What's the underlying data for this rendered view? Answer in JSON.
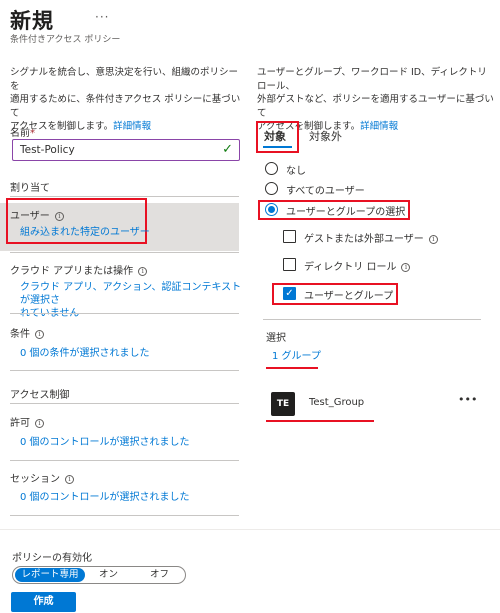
{
  "header": {
    "title": "新規",
    "more": "···",
    "subtitle": "条件付きアクセス ポリシー"
  },
  "left": {
    "description_line1": "シグナルを統合し、意思決定を行い、組織のポリシーを",
    "description_line2": "適用するために、条件付きアクセス ポリシーに基づいて",
    "description_line3": "アクセスを制御します。",
    "description_link": "詳細情報",
    "name_label": "名前",
    "name_required": "*",
    "name_value": "Test-Policy",
    "assignments_heading": "割り当て",
    "users_label": "ユーザー",
    "users_value": "組み込まれた特定のユーザー",
    "cloud_apps_label": "クラウド アプリまたは操作",
    "cloud_apps_value_line1": "クラウド アプリ、アクション、認証コンテキストが選択さ",
    "cloud_apps_value_line2": "れていません",
    "conditions_label": "条件",
    "conditions_value": "0 個の条件が選択されました",
    "access_controls_heading": "アクセス制御",
    "grant_label": "許可",
    "grant_value": "0 個のコントロールが選択されました",
    "session_label": "セッション",
    "session_value": "0 個のコントロールが選択されました"
  },
  "right": {
    "description_line1": "ユーザーとグループ、ワークロード ID、ディレクトリ ロール、",
    "description_line2": "外部ゲストなど、ポリシーを適用するユーザーに基づいて",
    "description_line3": "アクセスを制御します。",
    "description_link": "詳細情報",
    "tab_include": "対象",
    "tab_exclude": "対象外",
    "radio_none": "なし",
    "radio_all_users": "すべてのユーザー",
    "radio_select": "ユーザーとグループの選択",
    "check_guest": "ゲストまたは外部ユーザー",
    "check_directory_roles": "ディレクトリ ロール",
    "check_users_groups": "ユーザーとグループ",
    "select_label": "選択",
    "select_value": "1 グループ",
    "group_initials": "TE",
    "group_name": "Test_Group",
    "group_more": "•••"
  },
  "footer": {
    "enable_label": "ポリシーの有効化",
    "toggle_report": "レポート専用",
    "toggle_on": "オン",
    "toggle_off": "オフ",
    "create_button": "作成"
  },
  "colors": {
    "accent": "#0078d4",
    "highlight_border": "#e81123",
    "selected_bg": "#e1dfdd"
  }
}
